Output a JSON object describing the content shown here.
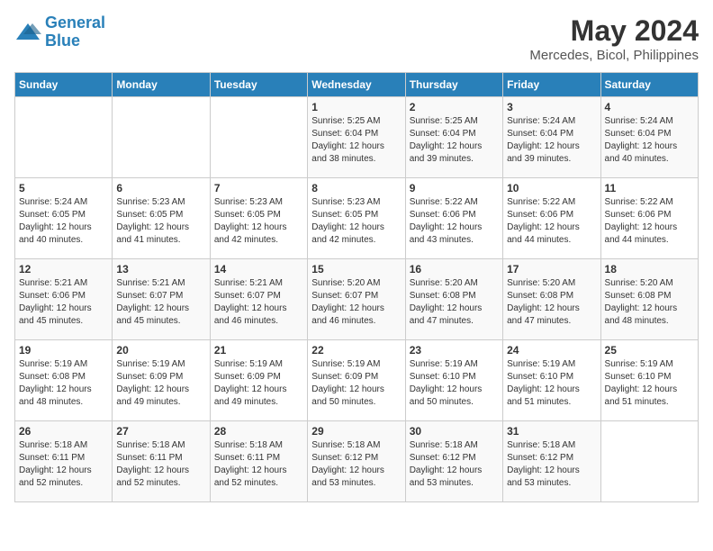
{
  "logo": {
    "line1": "General",
    "line2": "Blue"
  },
  "title": "May 2024",
  "subtitle": "Mercedes, Bicol, Philippines",
  "header_days": [
    "Sunday",
    "Monday",
    "Tuesday",
    "Wednesday",
    "Thursday",
    "Friday",
    "Saturday"
  ],
  "weeks": [
    [
      {
        "day": "",
        "sunrise": "",
        "sunset": "",
        "daylight": ""
      },
      {
        "day": "",
        "sunrise": "",
        "sunset": "",
        "daylight": ""
      },
      {
        "day": "",
        "sunrise": "",
        "sunset": "",
        "daylight": ""
      },
      {
        "day": "1",
        "sunrise": "5:25 AM",
        "sunset": "6:04 PM",
        "daylight": "12 hours and 38 minutes."
      },
      {
        "day": "2",
        "sunrise": "5:25 AM",
        "sunset": "6:04 PM",
        "daylight": "12 hours and 39 minutes."
      },
      {
        "day": "3",
        "sunrise": "5:24 AM",
        "sunset": "6:04 PM",
        "daylight": "12 hours and 39 minutes."
      },
      {
        "day": "4",
        "sunrise": "5:24 AM",
        "sunset": "6:04 PM",
        "daylight": "12 hours and 40 minutes."
      }
    ],
    [
      {
        "day": "5",
        "sunrise": "5:24 AM",
        "sunset": "6:05 PM",
        "daylight": "12 hours and 40 minutes."
      },
      {
        "day": "6",
        "sunrise": "5:23 AM",
        "sunset": "6:05 PM",
        "daylight": "12 hours and 41 minutes."
      },
      {
        "day": "7",
        "sunrise": "5:23 AM",
        "sunset": "6:05 PM",
        "daylight": "12 hours and 42 minutes."
      },
      {
        "day": "8",
        "sunrise": "5:23 AM",
        "sunset": "6:05 PM",
        "daylight": "12 hours and 42 minutes."
      },
      {
        "day": "9",
        "sunrise": "5:22 AM",
        "sunset": "6:06 PM",
        "daylight": "12 hours and 43 minutes."
      },
      {
        "day": "10",
        "sunrise": "5:22 AM",
        "sunset": "6:06 PM",
        "daylight": "12 hours and 44 minutes."
      },
      {
        "day": "11",
        "sunrise": "5:22 AM",
        "sunset": "6:06 PM",
        "daylight": "12 hours and 44 minutes."
      }
    ],
    [
      {
        "day": "12",
        "sunrise": "5:21 AM",
        "sunset": "6:06 PM",
        "daylight": "12 hours and 45 minutes."
      },
      {
        "day": "13",
        "sunrise": "5:21 AM",
        "sunset": "6:07 PM",
        "daylight": "12 hours and 45 minutes."
      },
      {
        "day": "14",
        "sunrise": "5:21 AM",
        "sunset": "6:07 PM",
        "daylight": "12 hours and 46 minutes."
      },
      {
        "day": "15",
        "sunrise": "5:20 AM",
        "sunset": "6:07 PM",
        "daylight": "12 hours and 46 minutes."
      },
      {
        "day": "16",
        "sunrise": "5:20 AM",
        "sunset": "6:08 PM",
        "daylight": "12 hours and 47 minutes."
      },
      {
        "day": "17",
        "sunrise": "5:20 AM",
        "sunset": "6:08 PM",
        "daylight": "12 hours and 47 minutes."
      },
      {
        "day": "18",
        "sunrise": "5:20 AM",
        "sunset": "6:08 PM",
        "daylight": "12 hours and 48 minutes."
      }
    ],
    [
      {
        "day": "19",
        "sunrise": "5:19 AM",
        "sunset": "6:08 PM",
        "daylight": "12 hours and 48 minutes."
      },
      {
        "day": "20",
        "sunrise": "5:19 AM",
        "sunset": "6:09 PM",
        "daylight": "12 hours and 49 minutes."
      },
      {
        "day": "21",
        "sunrise": "5:19 AM",
        "sunset": "6:09 PM",
        "daylight": "12 hours and 49 minutes."
      },
      {
        "day": "22",
        "sunrise": "5:19 AM",
        "sunset": "6:09 PM",
        "daylight": "12 hours and 50 minutes."
      },
      {
        "day": "23",
        "sunrise": "5:19 AM",
        "sunset": "6:10 PM",
        "daylight": "12 hours and 50 minutes."
      },
      {
        "day": "24",
        "sunrise": "5:19 AM",
        "sunset": "6:10 PM",
        "daylight": "12 hours and 51 minutes."
      },
      {
        "day": "25",
        "sunrise": "5:19 AM",
        "sunset": "6:10 PM",
        "daylight": "12 hours and 51 minutes."
      }
    ],
    [
      {
        "day": "26",
        "sunrise": "5:18 AM",
        "sunset": "6:11 PM",
        "daylight": "12 hours and 52 minutes."
      },
      {
        "day": "27",
        "sunrise": "5:18 AM",
        "sunset": "6:11 PM",
        "daylight": "12 hours and 52 minutes."
      },
      {
        "day": "28",
        "sunrise": "5:18 AM",
        "sunset": "6:11 PM",
        "daylight": "12 hours and 52 minutes."
      },
      {
        "day": "29",
        "sunrise": "5:18 AM",
        "sunset": "6:12 PM",
        "daylight": "12 hours and 53 minutes."
      },
      {
        "day": "30",
        "sunrise": "5:18 AM",
        "sunset": "6:12 PM",
        "daylight": "12 hours and 53 minutes."
      },
      {
        "day": "31",
        "sunrise": "5:18 AM",
        "sunset": "6:12 PM",
        "daylight": "12 hours and 53 minutes."
      },
      {
        "day": "",
        "sunrise": "",
        "sunset": "",
        "daylight": ""
      }
    ]
  ]
}
